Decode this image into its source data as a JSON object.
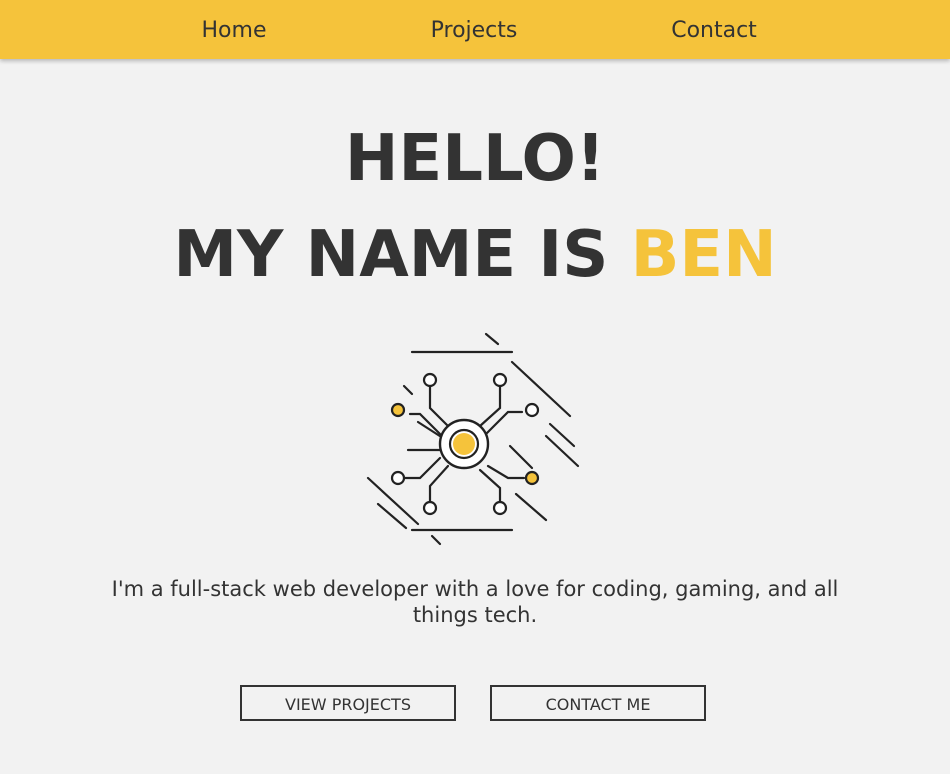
{
  "nav": {
    "links": [
      "Home",
      "Projects",
      "Contact"
    ]
  },
  "hero": {
    "greeting": "HELLO!",
    "intro_prefix": "MY NAME IS",
    "name": "BEN",
    "tagline": "I'm a full-stack web developer with a love for coding, gaming, and all things tech.",
    "illustration_icon": "circuit-chip-icon"
  },
  "buttons": {
    "view_projects": "VIEW PROJECTS",
    "contact_me": "CONTACT ME"
  },
  "colors": {
    "accent": "#f5c33b",
    "text": "#333333",
    "background": "#f2f2f2"
  }
}
